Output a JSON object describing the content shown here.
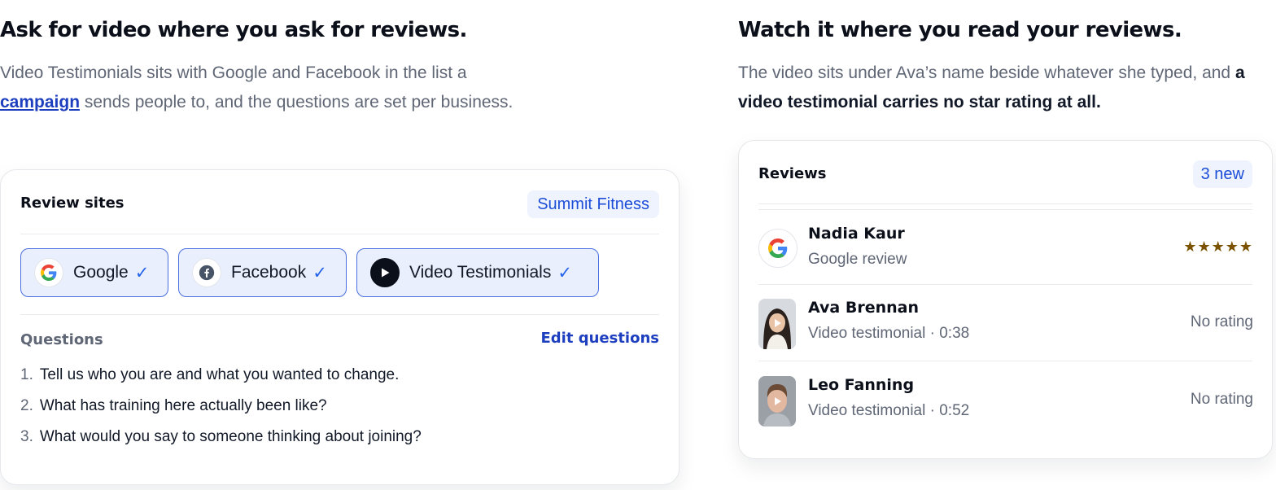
{
  "left": {
    "heading": "Ask for video where you ask for reviews.",
    "lead_part1": "Video Testimonials sits with Google and Facebook in the list a ",
    "lead_link": "campaign",
    "lead_part2": " sends people to, and the questions are set per business.",
    "card": {
      "title": "Review sites",
      "business": "Summit Fitness",
      "sites": [
        {
          "label": "Google",
          "check": "✓",
          "icon": "google-icon"
        },
        {
          "label": "Facebook",
          "check": "✓",
          "icon": "facebook-icon"
        },
        {
          "label": "Video Testimonials",
          "check": "✓",
          "icon": "play-icon"
        }
      ],
      "questions_title": "Questions",
      "edit_label": "Edit questions",
      "questions": [
        {
          "num": "1.",
          "text": "Tell us who you are and what you wanted to change."
        },
        {
          "num": "2.",
          "text": "What has training here actually been like?"
        },
        {
          "num": "3.",
          "text": "What would you say to someone thinking about joining?"
        }
      ]
    }
  },
  "right": {
    "heading": "Watch it where you read your reviews.",
    "lead_part1": "The video sits under Ava’s name beside whatever she typed, and ",
    "lead_bold": "a video testimonial carries no star rating at all.",
    "card": {
      "title": "Reviews",
      "badge": "3 new",
      "reviews": [
        {
          "name": "Nadia Kaur",
          "sub": "Google review",
          "rating": "★★★★★",
          "icon": "google-icon"
        },
        {
          "name": "Ava Brennan",
          "sub": "Video testimonial · 0:38",
          "rating": "No rating",
          "icon": "video-thumbnail"
        },
        {
          "name": "Leo Fanning",
          "sub": "Video testimonial · 0:52",
          "rating": "No rating",
          "icon": "video-thumbnail"
        }
      ]
    }
  },
  "colors": {
    "accent": "#1d4ed8",
    "link": "#1d3fbf",
    "chip_bg": "#e9effd",
    "chip_border": "#4a6fe0",
    "star": "#7a5200",
    "muted": "#5f6675"
  }
}
